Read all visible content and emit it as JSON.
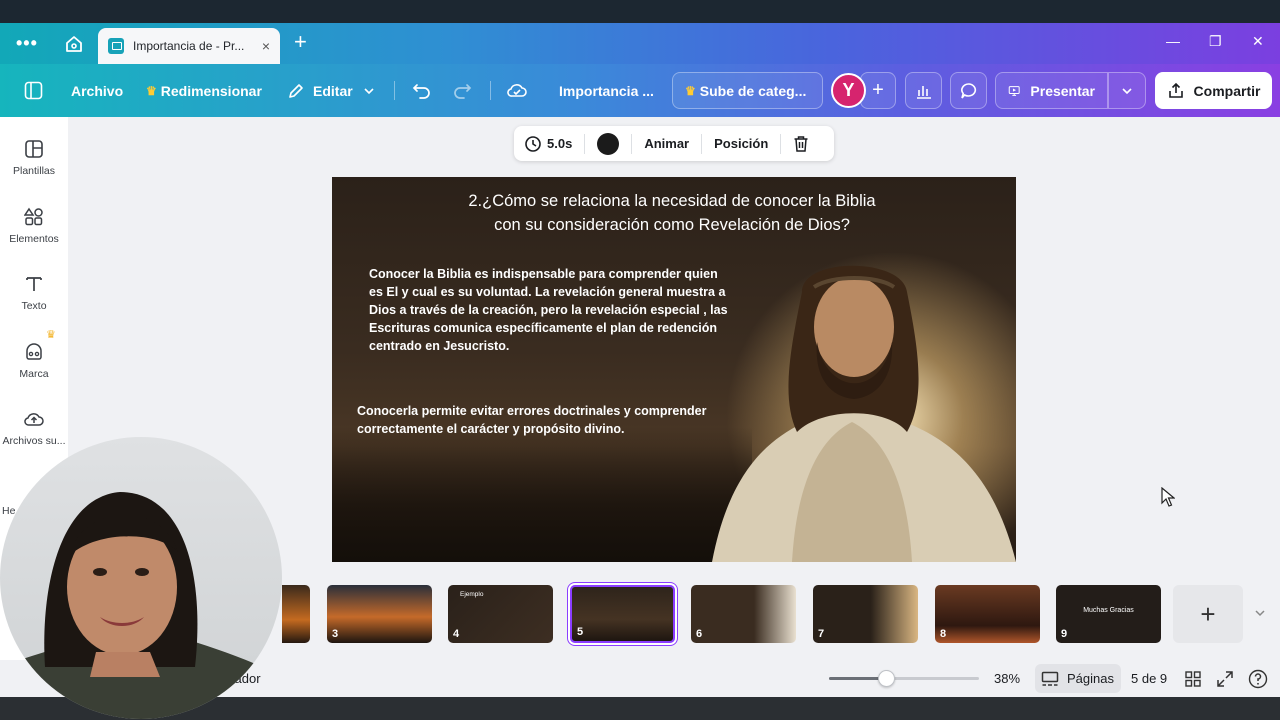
{
  "tab": {
    "title": "Importancia de - Pr...",
    "close": "×",
    "new": "+"
  },
  "toolbar": {
    "archivo": "Archivo",
    "redimensionar": "Redimensionar",
    "editar": "Editar",
    "doc_title": "Importancia ...",
    "upgrade": "Sube de categ...",
    "avatar_initial": "Y",
    "presentar": "Presentar",
    "compartir": "Compartir"
  },
  "sidebar": {
    "items": [
      {
        "label": "Plantillas"
      },
      {
        "label": "Elementos"
      },
      {
        "label": "Texto"
      },
      {
        "label": "Marca"
      },
      {
        "label": "Archivos su..."
      },
      {
        "label": "He"
      }
    ]
  },
  "context_bar": {
    "duration": "5.0s",
    "animar": "Animar",
    "posicion": "Posición"
  },
  "slide": {
    "title_line1": "2.¿Cómo se relaciona la necesidad de conocer la Biblia",
    "title_line2": "con su consideración como Revelación de Dios?",
    "paragraph1": "Conocer la Biblia es indispensable para comprender quien es El y cual es su voluntad. La revelación general muestra a Dios a través de la creación, pero la revelación especial , las Escrituras comunica específicamente el plan de redención centrado en Jesucristo.",
    "paragraph2": "Conocerla permite evitar errores doctrinales y comprender correctamente el carácter y propósito divino."
  },
  "thumbnails": [
    {
      "num": "3"
    },
    {
      "num": "4",
      "caption": "Ejemplo"
    },
    {
      "num": "5"
    },
    {
      "num": "6"
    },
    {
      "num": "7"
    },
    {
      "num": "8"
    },
    {
      "num": "9",
      "caption": "Muchas Gracias"
    }
  ],
  "footer": {
    "left_text": "zador",
    "zoom": "38%",
    "zoom_fraction": 0.38,
    "pages_label": "Páginas",
    "page_counter": "5 de 9"
  },
  "colors": {
    "accent": "#8b3dff",
    "avatar": "#d6246e",
    "crown": "#ffcc33"
  }
}
